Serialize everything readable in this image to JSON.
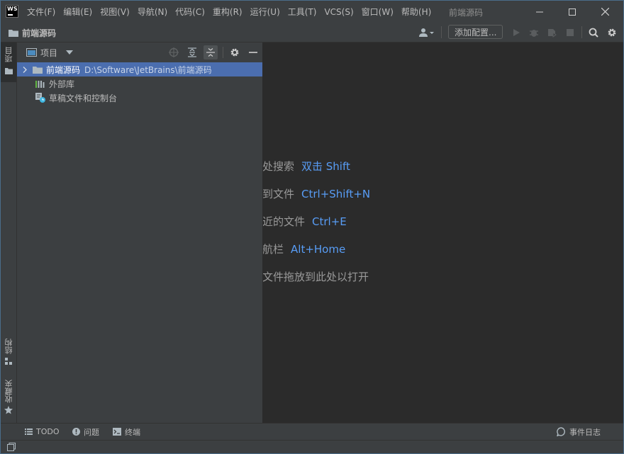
{
  "app": {
    "logo_text": "WS",
    "window_title": "前端源码"
  },
  "menu": [
    "文件(F)",
    "编辑(E)",
    "视图(V)",
    "导航(N)",
    "代码(C)",
    "重构(R)",
    "运行(U)",
    "工具(T)",
    "VCS(S)",
    "窗口(W)",
    "帮助(H)"
  ],
  "navbar": {
    "project_name": "前端源码",
    "add_config_label": "添加配置..."
  },
  "left_strip": {
    "project_tab": "项目",
    "structure_tab": "结构",
    "favorites_tab": "收藏夹"
  },
  "project_panel": {
    "title": "项目",
    "tree": [
      {
        "label": "前端源码",
        "path": "D:\\Software\\JetBrains\\前端源码",
        "selected": true
      },
      {
        "label": "外部库",
        "path": "",
        "selected": false
      },
      {
        "label": "草稿文件和控制台",
        "path": "",
        "selected": false
      }
    ]
  },
  "editor_hints": [
    {
      "text": "处搜索",
      "shortcut": "双击 Shift"
    },
    {
      "text": "到文件",
      "shortcut": "Ctrl+Shift+N"
    },
    {
      "text": "近的文件",
      "shortcut": "Ctrl+E"
    },
    {
      "text": "航栏",
      "shortcut": "Alt+Home"
    },
    {
      "text": "文件拖放到此处以打开",
      "shortcut": ""
    }
  ],
  "bottom_bar": {
    "todo": "TODO",
    "problems": "问题",
    "terminal": "终端",
    "event_log": "事件日志"
  },
  "colors": {
    "background": "#2b2b2b",
    "panel": "#3c3f41",
    "selection": "#4b6eaf",
    "shortcut": "#589df6",
    "text": "#bbbbbb"
  }
}
